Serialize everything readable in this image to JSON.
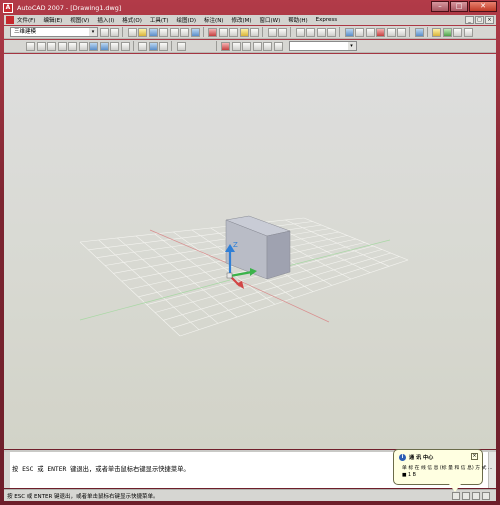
{
  "window": {
    "title": "AutoCAD 2007 - [Drawing1.dwg]",
    "app_icon_letter": "A",
    "controls": [
      "–",
      "□",
      "✕"
    ]
  },
  "menubar": {
    "items": [
      "文件(F)",
      "编辑(E)",
      "视图(V)",
      "插入(I)",
      "格式(O)",
      "工具(T)",
      "绘图(D)",
      "标注(N)",
      "修改(M)",
      "窗口(W)",
      "帮助(H)",
      "Express"
    ],
    "controls": [
      "_",
      "□",
      "×"
    ]
  },
  "toolbar": {
    "workspace_value": "三维建模",
    "combo_arrow": "▾",
    "layer_combo_value": ""
  },
  "command": {
    "line": "按 ESC 或 ENTER 键退出，或者单击鼠标右键显示快捷菜单。"
  },
  "status": {
    "text": "按 ESC 或 ENTER 键退出，或者单击鼠标右键显示快捷菜单。"
  },
  "balloon": {
    "title": "通 讯 中心",
    "line1": "单 标 在 线 信 息 (标 量 和 信 息) 方 式 ...",
    "line2": "■ 1 B",
    "close": "×",
    "info_icon": "i"
  },
  "ucs": {
    "z_label": "Z"
  },
  "colors": {
    "frame": "#7d2531",
    "background": "#d8d9d2",
    "grid": "#f2f2ee",
    "axis_red": "#d24545",
    "axis_green": "#3bb34a",
    "box_top": "#c9ccd6",
    "box_front": "#b6b9c3",
    "box_side": "#9a9dab"
  }
}
